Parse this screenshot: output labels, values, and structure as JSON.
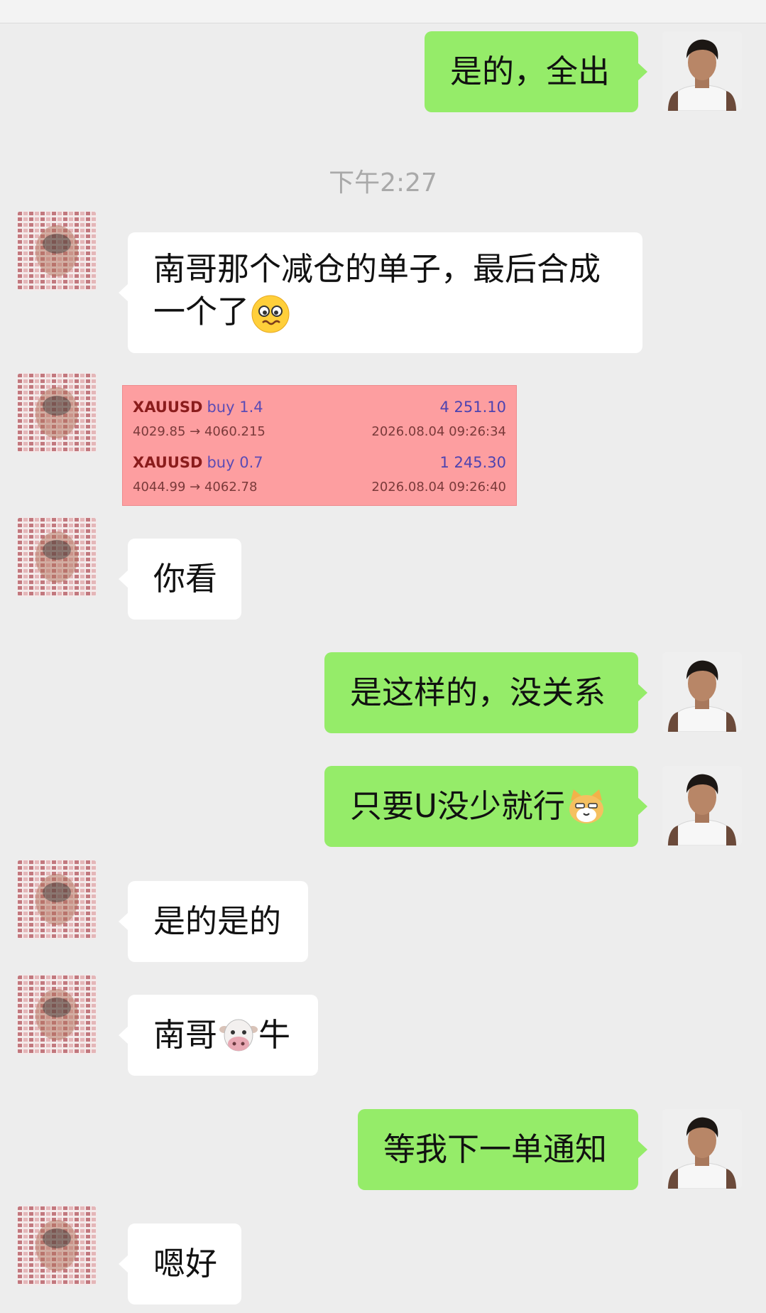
{
  "timestamp": "下午2:27",
  "messages": {
    "m1": {
      "text": "是的，全出"
    },
    "m2": {
      "line1": "南哥那个减仓的单子，最后合成",
      "line2": "一个了",
      "emoji": "woozy-face"
    },
    "m3": {
      "trades": [
        {
          "symbol": "XAUUSD",
          "side": "buy 1.4",
          "profit": "4 251.10",
          "range": "4029.85 → 4060.215",
          "time": "2026.08.04 09:26:34"
        },
        {
          "symbol": "XAUUSD",
          "side": "buy 0.7",
          "profit": "1 245.30",
          "range": "4044.99 → 4062.78",
          "time": "2026.08.04 09:26:40"
        }
      ]
    },
    "m4": {
      "text": "你看"
    },
    "m5": {
      "text": "是这样的，没关系"
    },
    "m6": {
      "text": "只要U没少就行",
      "emoji": "cat-face"
    },
    "m7": {
      "text": "是的是的"
    },
    "m8": {
      "before": "南哥",
      "after": "牛",
      "emoji": "cow-face"
    },
    "m9": {
      "text": "等我下一单通知"
    },
    "m10": {
      "text": "嗯好"
    }
  },
  "colors": {
    "my_bubble": "#95ec69",
    "other_bubble": "#ffffff",
    "background": "#ededed",
    "trade_card": "#fd9ea0"
  }
}
